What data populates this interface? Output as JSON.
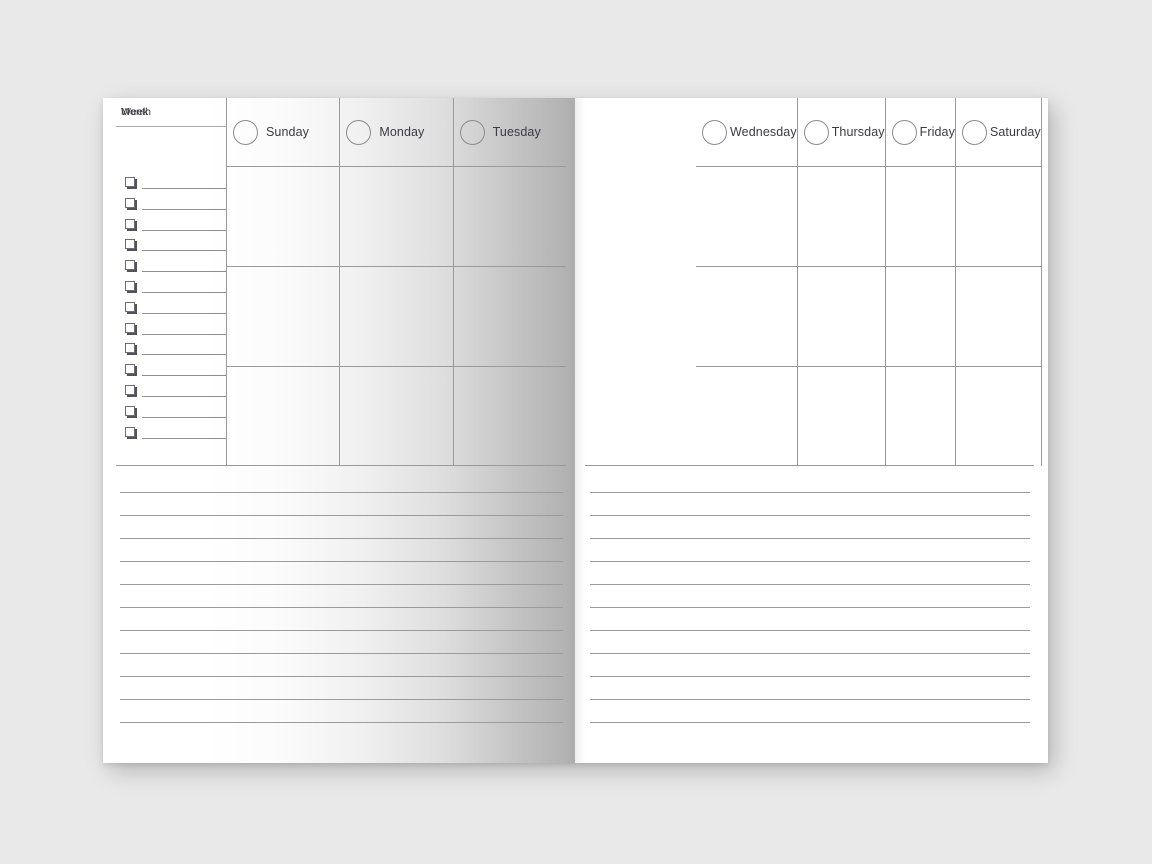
{
  "document": {
    "type": "weekly-planner-spread",
    "background_color": "#e9e9e9",
    "page_color": "#ffffff",
    "rule_color": "#9a9a9a",
    "text_color": "#3b3b42"
  },
  "left_page": {
    "sidebar": {
      "month_label": "Month",
      "week_label": "Week",
      "checkbox_count": 13,
      "checkbox_icon": "checkbox-empty-icon"
    },
    "days": [
      {
        "name": "Sunday",
        "circle_icon": "day-circle-icon",
        "cells": 3
      },
      {
        "name": "Monday",
        "circle_icon": "day-circle-icon",
        "cells": 3
      },
      {
        "name": "Tuesday",
        "circle_icon": "day-circle-icon",
        "cells": 3
      }
    ],
    "notes_line_count": 11
  },
  "right_page": {
    "days": [
      {
        "name": "Wednesday",
        "circle_icon": "day-circle-icon",
        "cells": 3
      },
      {
        "name": "Thursday",
        "circle_icon": "day-circle-icon",
        "cells": 3
      },
      {
        "name": "Friday",
        "circle_icon": "day-circle-icon",
        "cells": 3
      },
      {
        "name": "Saturday",
        "circle_icon": "day-circle-icon",
        "cells": 3
      }
    ],
    "notes_line_count": 11
  }
}
